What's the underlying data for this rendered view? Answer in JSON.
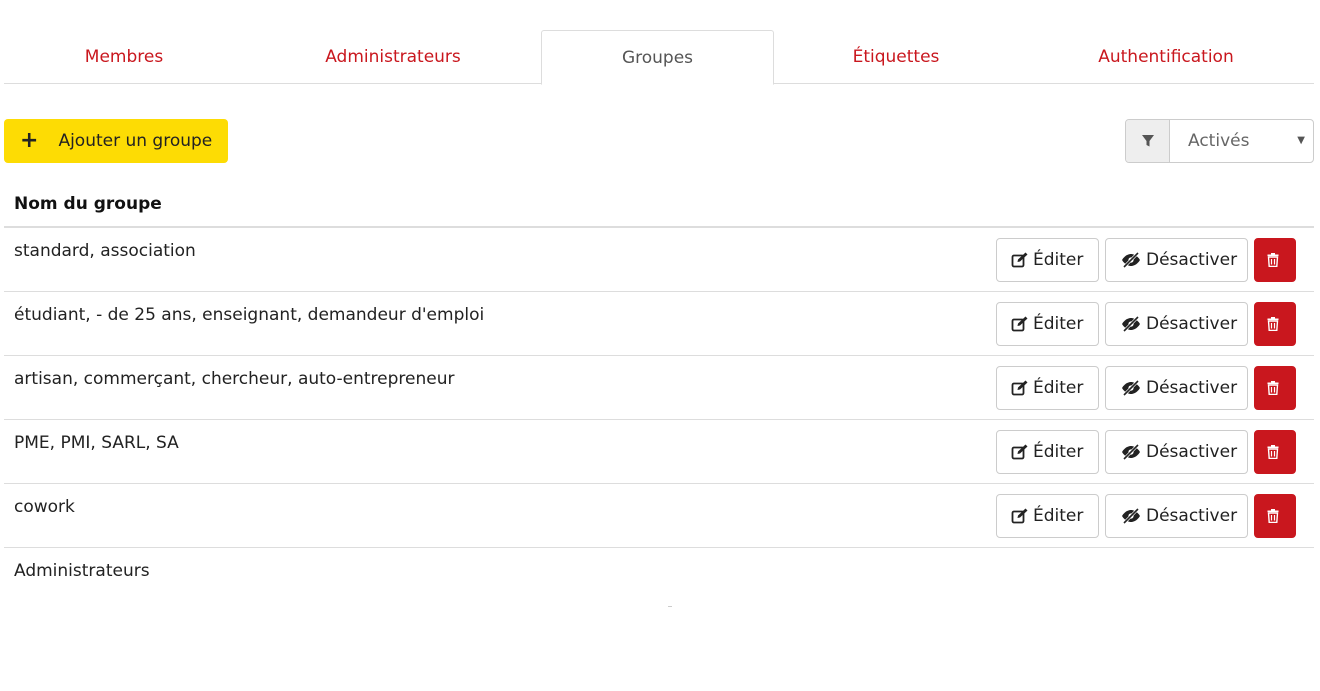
{
  "tabs": [
    {
      "label": "Membres",
      "active": false
    },
    {
      "label": "Administrateurs",
      "active": false
    },
    {
      "label": "Groupes",
      "active": true
    },
    {
      "label": "Étiquettes",
      "active": false
    },
    {
      "label": "Authentification",
      "active": false
    }
  ],
  "toolbar": {
    "add_label": "Ajouter un groupe",
    "add_icon": "plus-icon",
    "filter_icon": "filter-icon",
    "filter_value": "Activés"
  },
  "table": {
    "header": "Nom du groupe",
    "rows": [
      {
        "name": "standard, association"
      },
      {
        "name": "étudiant, - de 25 ans, enseignant, demandeur d'emploi"
      },
      {
        "name": "artisan, commerçant, chercheur, auto-entrepreneur"
      },
      {
        "name": "PME, PMI, SARL, SA"
      },
      {
        "name": "cowork"
      }
    ],
    "last_row": "Administrateurs",
    "edit_label": "Éditer",
    "disable_label": "Désactiver"
  },
  "colors": {
    "accent": "#c9171e",
    "add_button": "#fddc04",
    "border": "#dddddd"
  }
}
